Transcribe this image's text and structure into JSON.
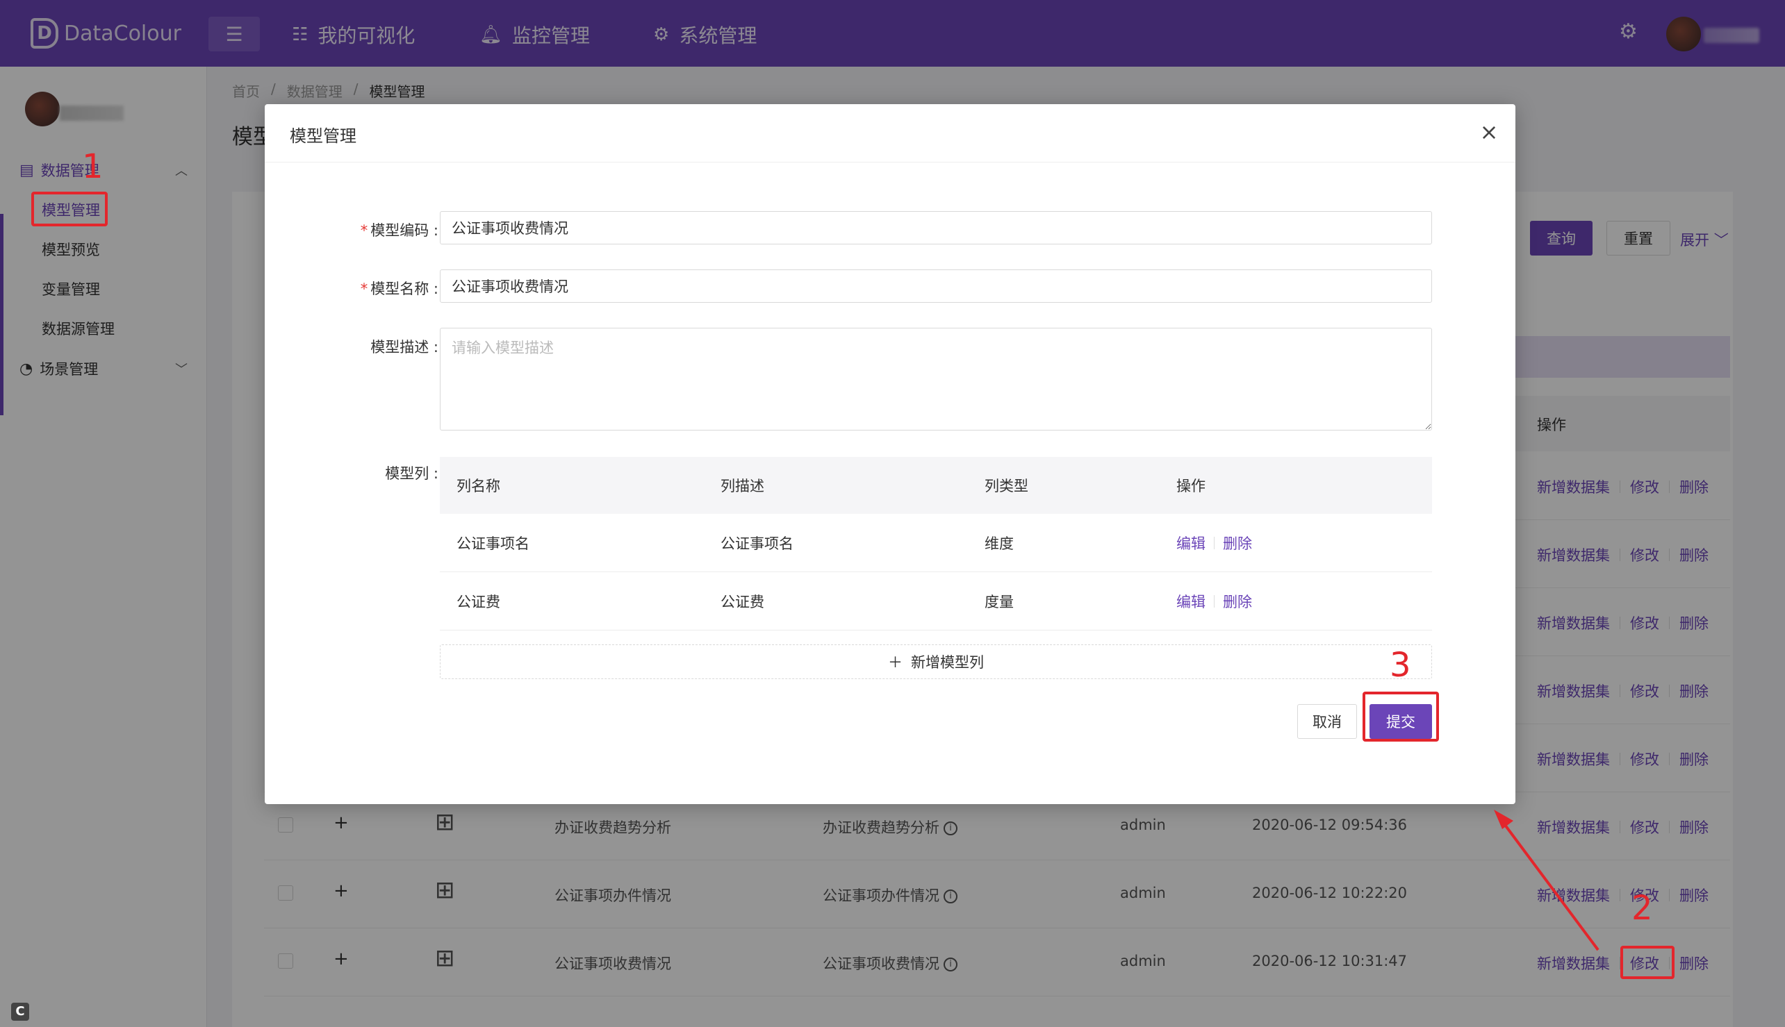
{
  "app": {
    "logo_text": "DataColour",
    "top_nav": [
      {
        "label": "我的可视化",
        "icon": "list-icon"
      },
      {
        "label": "监控管理",
        "icon": "bell-icon"
      },
      {
        "label": "系统管理",
        "icon": "gear-icon"
      }
    ]
  },
  "sidebar": {
    "groups": [
      {
        "label": "数据管理",
        "icon": "database-icon",
        "expanded": true,
        "items": [
          "模型管理",
          "模型预览",
          "变量管理",
          "数据源管理"
        ]
      },
      {
        "label": "场景管理",
        "icon": "dashboard-icon",
        "expanded": false
      }
    ],
    "active_item": "模型管理"
  },
  "breadcrumb": [
    "首页",
    "数据管理",
    "模型管理"
  ],
  "page": {
    "title": "模型管理",
    "query_button": "查询",
    "reset_button": "重置",
    "expand_link": "展开",
    "ops_header": "操作",
    "row_ops": [
      "新增数据集",
      "修改",
      "删除"
    ],
    "visible_rows": [
      {
        "name": "办证收费趋势分析",
        "desc": "办证收费趋势分析",
        "owner": "admin",
        "time": "2020-06-12 09:54:36"
      },
      {
        "name": "公证事项办件情况",
        "desc": "公证事项办件情况",
        "owner": "admin",
        "time": "2020-06-12 10:22:20"
      },
      {
        "name": "公证事项收费情况",
        "desc": "公证事项收费情况",
        "owner": "admin",
        "time": "2020-06-12 10:31:47"
      }
    ]
  },
  "modal": {
    "title": "模型管理",
    "fields": {
      "code_label": "模型编码 :",
      "code_value": "公证事项收费情况",
      "name_label": "模型名称 :",
      "name_value": "公证事项收费情况",
      "desc_label": "模型描述 :",
      "desc_placeholder": "请输入模型描述",
      "cols_label": "模型列 :"
    },
    "columns_table": {
      "headers": [
        "列名称",
        "列描述",
        "列类型",
        "操作"
      ],
      "rows": [
        {
          "name": "公证事项名",
          "desc": "公证事项名",
          "type": "维度"
        },
        {
          "name": "公证费",
          "desc": "公证费",
          "type": "度量"
        }
      ],
      "row_actions": [
        "编辑",
        "删除"
      ]
    },
    "add_column_label": "新增模型列",
    "cancel_label": "取消",
    "submit_label": "提交"
  },
  "annotations": [
    "1",
    "2",
    "3"
  ],
  "colors": {
    "brand": "#6b45b8",
    "annotation": "#e3262c"
  }
}
